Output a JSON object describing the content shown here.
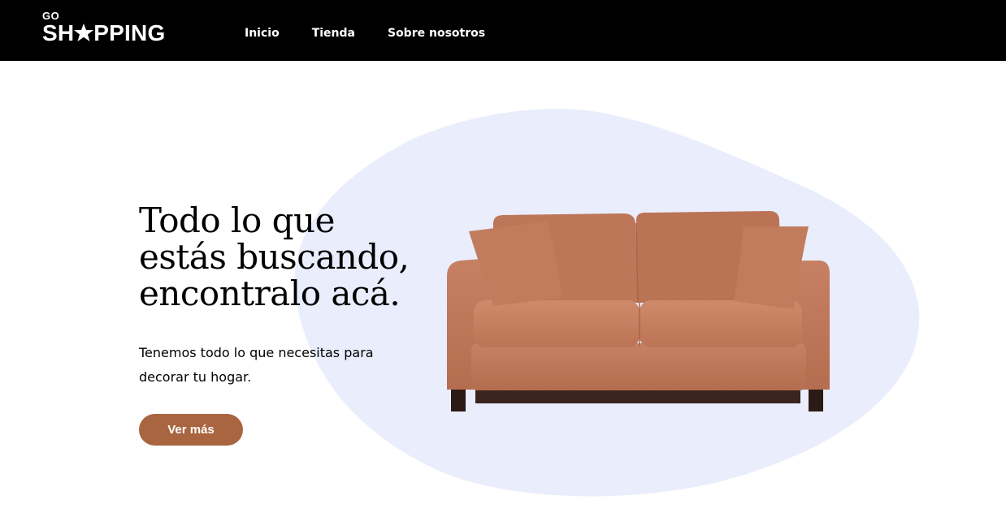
{
  "header": {
    "logo_top": "GO",
    "logo_left": "SH",
    "logo_right": "PPING",
    "nav": {
      "inicio": "Inicio",
      "tienda": "Tienda",
      "sobre": "Sobre nosotros"
    }
  },
  "hero": {
    "title_line1": "Todo lo que",
    "title_line2": "estás buscando,",
    "title_line3": "encontralo acá.",
    "text_line1": "Tenemos todo lo que necesitas para",
    "text_line2": "decorar tu hogar.",
    "cta_label": "Ver más"
  },
  "colors": {
    "header_bg": "#000000",
    "blob": "#eaedfc",
    "accent": "#a9653f",
    "sofa": "#c07a5c"
  },
  "icons": {
    "logo_star": "star-icon",
    "product_image": "sofa-image"
  }
}
